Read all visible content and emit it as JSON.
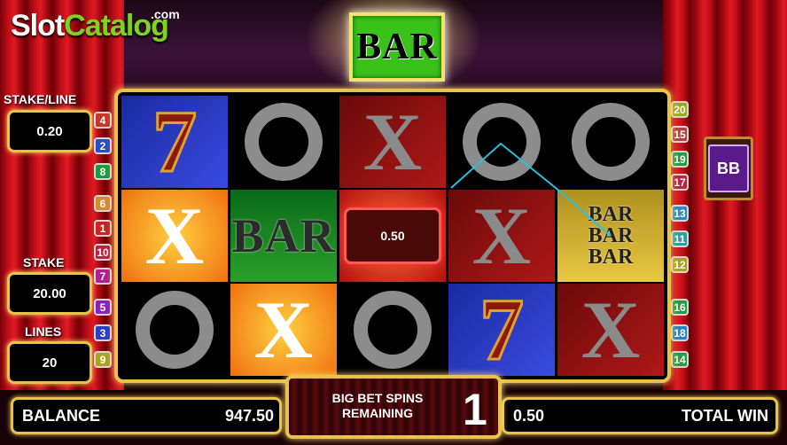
{
  "logo": {
    "part1": "Slot",
    "part2": "Catalog",
    "domain": ".com"
  },
  "top_symbol": "BAR",
  "stake_line": {
    "label": "STAKE/LINE",
    "value": "0.20"
  },
  "stake": {
    "label": "STAKE",
    "value": "20.00"
  },
  "lines": {
    "label": "LINES",
    "value": "20"
  },
  "left_line_tags": [
    {
      "n": "4",
      "color": "#c0392b"
    },
    {
      "n": "2",
      "color": "#2c4cc7"
    },
    {
      "n": "8",
      "color": "#1e9a3a"
    },
    {
      "n": "6",
      "color": "#d8892a"
    },
    {
      "n": "1",
      "color": "#d02020"
    },
    {
      "n": "10",
      "color": "#c02040"
    },
    {
      "n": "7",
      "color": "#b0208a"
    },
    {
      "n": "5",
      "color": "#8a20c0"
    },
    {
      "n": "3",
      "color": "#2a40c0"
    },
    {
      "n": "9",
      "color": "#b0a020"
    }
  ],
  "right_line_tags": [
    {
      "n": "20",
      "color": "#9aaa20"
    },
    {
      "n": "15",
      "color": "#b04040"
    },
    {
      "n": "19",
      "color": "#2a9a40"
    },
    {
      "n": "17",
      "color": "#c02040"
    },
    {
      "n": "13",
      "color": "#2a8ac0"
    },
    {
      "n": "11",
      "color": "#2aa0a0"
    },
    {
      "n": "12",
      "color": "#b0a020"
    },
    {
      "n": "16",
      "color": "#2a9a40"
    },
    {
      "n": "18",
      "color": "#2a80c0"
    },
    {
      "n": "14",
      "color": "#2a9a40"
    }
  ],
  "reels": [
    [
      "7",
      "X",
      "O"
    ],
    [
      "O",
      "BAR",
      "X"
    ],
    [
      "X",
      "WIN",
      "O"
    ],
    [
      "O",
      "X",
      "7"
    ],
    [
      "O",
      "BARBARBAR",
      "X"
    ]
  ],
  "win_amount": "0.50",
  "balance": {
    "label": "BALANCE",
    "value": "947.50"
  },
  "big_bet": {
    "line1": "BIG BET SPINS",
    "line2": "REMAINING",
    "count": "1"
  },
  "total_win": {
    "label": "TOTAL WIN",
    "value": "0.50"
  },
  "colors": {
    "frame_gold": "#e8c24a",
    "curtain_red": "#c4101a",
    "bar_green": "#3ac21a"
  }
}
